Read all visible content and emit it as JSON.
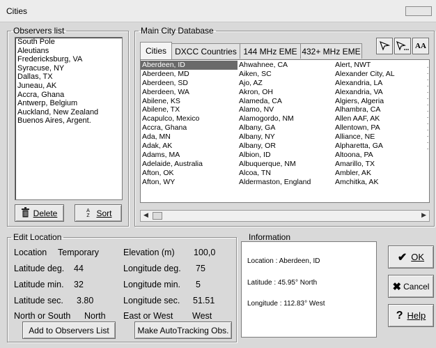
{
  "window": {
    "title": "Cities"
  },
  "observers": {
    "legend": "Observers list",
    "items": [
      "South Pole",
      "Aleutians",
      "Fredericksburg, VA",
      "Syracuse, NY",
      "Dallas, TX",
      "Juneau, AK",
      "Accra, Ghana",
      "Antwerp, Belgium",
      "Auckland, New Zealand",
      "Buenos Aires, Argent."
    ],
    "delete_label": "Delete",
    "sort_label": "Sort",
    "sort_icon_text": "A Z"
  },
  "database": {
    "legend": "Main City Database",
    "tabs": [
      "Cities",
      "DXCC Countries",
      "144 MHz EME",
      "432+ MHz EME"
    ],
    "active_tab": "Cities",
    "font_button_label": "AA",
    "columns": [
      [
        "Aberdeen, ID",
        "Aberdeen, MD",
        "Aberdeen, SD",
        "Aberdeen, WA",
        "Abilene, KS",
        "Abilene, TX",
        "Acapulco, Mexico",
        "Accra, Ghana",
        "Ada, MN",
        "Adak, AK",
        "Adams, MA",
        "Adelaide, Australia",
        "Afton, OK",
        "Afton, WY"
      ],
      [
        "Ahwahnee, CA",
        "Aiken, SC",
        "Ajo, AZ",
        "Akron, OH",
        "Alameda, CA",
        "Alamo, NV",
        "Alamogordo, NM",
        "Albany, GA",
        "Albany, NY",
        "Albany, OR",
        "Albion, ID",
        "Albuquerque, NM",
        "Alcoa, TN",
        "Aldermaston, England"
      ],
      [
        "Alert, NWT",
        "Alexander City, AL",
        "Alexandria, LA",
        "Alexandria, VA",
        "Algiers, Algeria",
        "Alhambra, CA",
        "Allen AAF, AK",
        "Allentown, PA",
        "Alliance, NE",
        "Alpharetta, GA",
        "Altoona, PA",
        "Amarillo, TX",
        "Ambler, AK",
        "Amchitka, AK"
      ]
    ],
    "selected": "Aberdeen, ID"
  },
  "edit": {
    "legend": "Edit Location",
    "location_label": "Location",
    "location_value": "Temporary",
    "lat_deg_label": "Latitude deg.",
    "lat_deg_value": "44",
    "lat_min_label": "Latitude min.",
    "lat_min_value": "32",
    "lat_sec_label": "Latitude sec.",
    "lat_sec_value": "3.80",
    "ns_label": "North or South",
    "ns_value": "North",
    "elev_label": "Elevation (m)",
    "elev_value": "100,0",
    "lon_deg_label": "Longitude deg.",
    "lon_deg_value": "75",
    "lon_min_label": "Longitude min.",
    "lon_min_value": "5",
    "lon_sec_label": "Longitude sec.",
    "lon_sec_value": "51.51",
    "ew_label": "East or West",
    "ew_value": "West",
    "add_label": "Add to Observers List",
    "autotrack_label": "Make AutoTracking Obs."
  },
  "info": {
    "legend": "Information",
    "location": "Location : Aberdeen, ID",
    "latitude": "Latitude : 45.95° North",
    "longitude": "Longitude : 112.83° West"
  },
  "actions": {
    "ok": "OK",
    "cancel": "Cancel",
    "help": "Help"
  }
}
